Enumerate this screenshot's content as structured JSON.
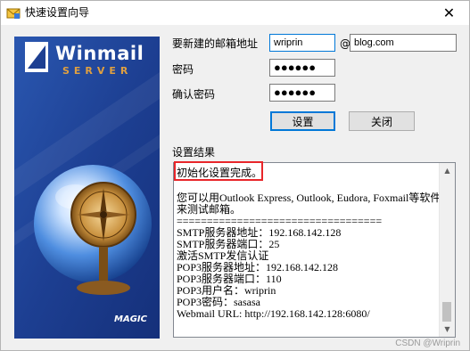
{
  "window": {
    "title": "快速设置向导",
    "close_glyph": "✕"
  },
  "banner": {
    "logo_text": "Winmail",
    "logo_sub": "SERVER",
    "maker": "MAGIC"
  },
  "form": {
    "email_label": "要新建的邮箱地址",
    "username_value": "wriprin",
    "at_sign": "@",
    "domain_value": "blog.com",
    "password_label": "密码",
    "password_value": "●●●●●●",
    "confirm_label": "确认密码",
    "confirm_value": "●●●●●●",
    "setup_button": "设置",
    "close_button": "关闭"
  },
  "result": {
    "label": "设置结果",
    "lines": [
      "初始化设置完成。",
      "",
      "您可以用Outlook Express, Outlook, Eudora, Foxmail等软件",
      "来测试邮箱。",
      "==================================",
      "SMTP服务器地址：192.168.142.128",
      "SMTP服务器端口：25",
      "激活SMTP发信认证",
      "POP3服务器地址：192.168.142.128",
      "POP3服务器端口：110",
      "POP3用户名：wriprin",
      "POP3密码：sasasa",
      "Webmail URL: http://192.168.142.128:6080/"
    ],
    "scroll_up_glyph": "▲",
    "scroll_down_glyph": "▼"
  },
  "watermark": "CSDN @Wriprin",
  "icons": {
    "app": "envelope-icon",
    "close": "close-icon"
  },
  "colors": {
    "highlight_border": "#e8262a",
    "banner_blue": "#1c3f8c",
    "button_focus": "#0078d7"
  }
}
